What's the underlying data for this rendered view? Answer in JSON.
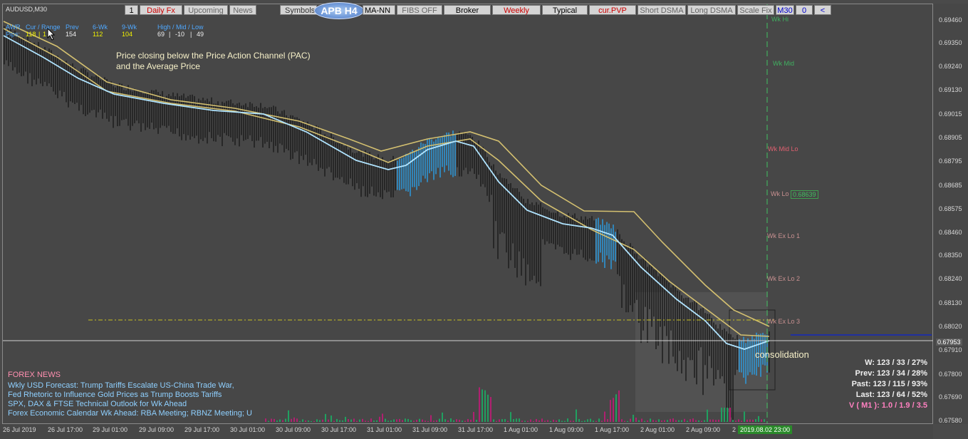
{
  "symbol_title": "AUDUSD,M30",
  "toolbar": {
    "tf_value": "1",
    "daily_fx": "Daily Fx",
    "upcoming": "Upcoming",
    "news": "News",
    "symbols": "Symbols",
    "logo": "APB H4",
    "ma_nn": "MA-NN",
    "fibs_off": "FIBS OFF",
    "broker": "Broker",
    "weekly": "Weekly",
    "typical": "Typical",
    "cur_pvp": "cur.PVP",
    "short_dsma": "Short DSMA",
    "long_dsma": "Long DSMA",
    "scale_fix": "Scale Fix",
    "m30": "M30",
    "zero": "0",
    "arrow": "<"
  },
  "stats_table": {
    "awr": "AWR",
    "cur_range": "Cur / Range",
    "prev": "Prev",
    "six_wk": "6-Wk",
    "nine_wk": "9-Wk",
    "hml": "High / Mid / Low",
    "pips_label": "Pips:",
    "cur_val": "118",
    "range_val": "1",
    "prev_val": "154",
    "six_val": "112",
    "nine_val": "104",
    "high_val": "69",
    "mid_val": "-10",
    "low_val": "49",
    "sep": "|"
  },
  "annotation": {
    "line1": "Price closing below the Price Action Channel  (PAC)",
    "line2": "and the Average Price",
    "consolidation": "consolidation"
  },
  "levels": {
    "wk_hi": "Wk Hi",
    "wk_mid": "Wk Mid",
    "wk_mid_lo": "Wk Mid Lo",
    "wk_lo": "Wk Lo",
    "wk_lo_price": "0.68639",
    "wk_ex_lo1": "Wk Ex Lo 1",
    "wk_ex_lo2": "Wk Ex Lo 2",
    "wk_ex_lo3": "Wk Ex Lo 3"
  },
  "price_axis": [
    "0.69460",
    "0.69350",
    "0.69240",
    "0.69130",
    "0.69015",
    "0.68905",
    "0.68795",
    "0.68685",
    "0.68575",
    "0.68460",
    "0.68350",
    "0.68240",
    "0.68130",
    "0.68020",
    "0.67910",
    "0.67800",
    "0.67690",
    "0.67580"
  ],
  "current_price": "0.67953",
  "time_axis": [
    "26 Jul 2019",
    "26 Jul 17:00",
    "29 Jul 01:00",
    "29 Jul 09:00",
    "29 Jul 17:00",
    "30 Jul 01:00",
    "30 Jul 09:00",
    "30 Jul 17:00",
    "31 Jul 01:00",
    "31 Jul 09:00",
    "31 Jul 17:00",
    "1 Aug 01:00",
    "1 Aug 09:00",
    "1 Aug 17:00",
    "2 Aug 01:00",
    "2 Aug 09:00",
    "2"
  ],
  "time_current": "2019.08.02 23:00",
  "news": {
    "title": "FOREX NEWS",
    "items": [
      "Wkly USD Forecast: Trump Tariffs Escalate US-China Trade War,",
      "Fed Rhetoric to Influence Gold Prices as Trump Boosts Tariffs",
      "SPX, DAX & FTSE Technical Outlook for Wk Ahead",
      "Forex Economic Calendar Wk Ahead: RBA Meeting; RBNZ Meeting; U"
    ]
  },
  "right_stats": {
    "w": "W: 123 / 33 / 27%",
    "prev": "Prev: 123 / 34 / 28%",
    "past": "Past: 123 / 115 / 93%",
    "last": "Last: 123 / 64 / 52%",
    "v": "V ( M1 ): 1.0 / 1.9 / 3.5"
  },
  "colors": {
    "background": "#474747",
    "candles": "#1a1a1a",
    "avg_line": "#b0e4ff",
    "pac_line": "#d4c070",
    "blue_bars": "#2aa0e8",
    "level_dash": "#c8c020",
    "volume_green": "#20a060",
    "volume_magenta": "#b02070",
    "price_box": "#2a6a2a"
  }
}
